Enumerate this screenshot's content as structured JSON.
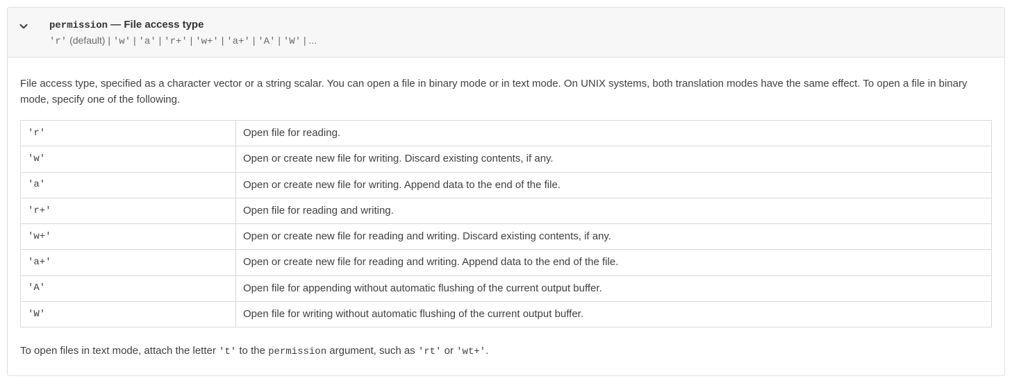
{
  "header": {
    "param_name": "permission",
    "dash": " — ",
    "title_desc": "File access type",
    "options_prefix": "",
    "options": [
      "'r'",
      "'w'",
      "'a'",
      "'r+'",
      "'w+'",
      "'a+'",
      "'A'",
      "'W'"
    ],
    "options_default_note": " (default)",
    "options_sep": " | ",
    "options_trailing": " | ..."
  },
  "body": {
    "description": "File access type, specified as a character vector or a string scalar. You can open a file in binary mode or in text mode. On UNIX systems, both translation modes have the same effect. To open a file in binary mode, specify one of the following.",
    "table": [
      {
        "mode": "'r'",
        "desc": "Open file for reading."
      },
      {
        "mode": "'w'",
        "desc": "Open or create new file for writing. Discard existing contents, if any."
      },
      {
        "mode": "'a'",
        "desc": "Open or create new file for writing. Append data to the end of the file."
      },
      {
        "mode": "'r+'",
        "desc": "Open file for reading and writing."
      },
      {
        "mode": "'w+'",
        "desc": "Open or create new file for reading and writing. Discard existing contents, if any."
      },
      {
        "mode": "'a+'",
        "desc": "Open or create new file for reading and writing. Append data to the end of the file."
      },
      {
        "mode": "'A'",
        "desc": "Open file for appending without automatic flushing of the current output buffer."
      },
      {
        "mode": "'W'",
        "desc": "Open file for writing without automatic flushing of the current output buffer."
      }
    ],
    "trailing": {
      "pre": "To open files in text mode, attach the letter ",
      "letter": "'t'",
      "mid": " to the ",
      "arg": "permission",
      "post": " argument, such as ",
      "ex1": "'rt'",
      "or": " or ",
      "ex2": "'wt+'",
      "end": "."
    }
  }
}
